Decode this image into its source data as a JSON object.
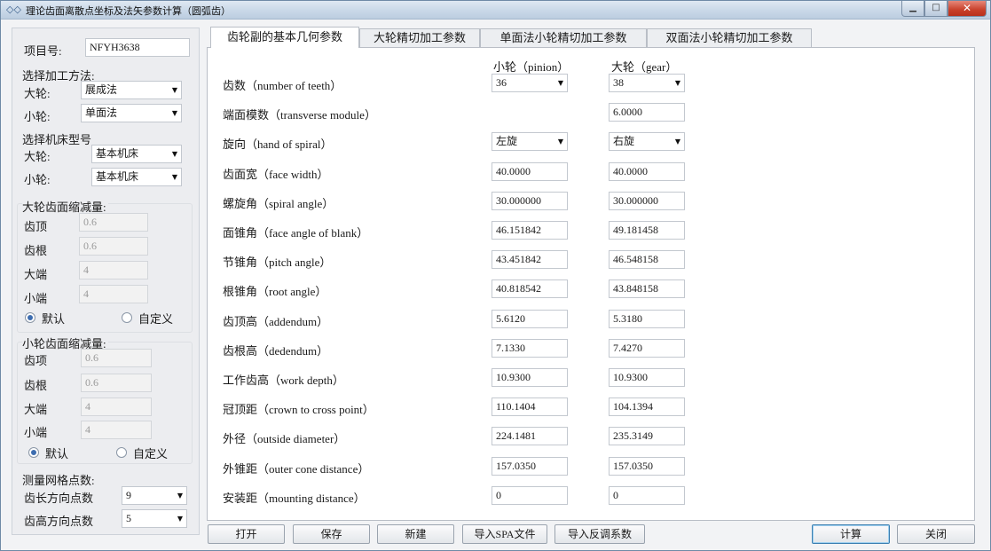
{
  "window": {
    "title": "理论齿面离散点坐标及法矢参数计算（圆弧齿）"
  },
  "left": {
    "project_label": "项目号:",
    "project_value": "NFYH3638",
    "process_title": "选择加工方法:",
    "gear_label": "大轮:",
    "gear_method": "展成法",
    "pinion_label": "小轮:",
    "pinion_method": "单面法",
    "machine_title": "选择机床型号",
    "gear_machine": "基本机床",
    "pinion_machine": "基本机床",
    "gear_reduction": {
      "title": "大轮齿面缩减量:",
      "rows": [
        {
          "label": "齿顶",
          "value": "0.6"
        },
        {
          "label": "齿根",
          "value": "0.6"
        },
        {
          "label": "大端",
          "value": "4"
        },
        {
          "label": "小端",
          "value": "4"
        }
      ],
      "default_label": "默认",
      "custom_label": "自定义"
    },
    "pinion_reduction": {
      "title": "小轮齿面缩减量:",
      "rows": [
        {
          "label": "齿项",
          "value": "0.6"
        },
        {
          "label": "齿根",
          "value": "0.6"
        },
        {
          "label": "大端",
          "value": "4"
        },
        {
          "label": "小端",
          "value": "4"
        }
      ],
      "default_label": "默认",
      "custom_label": "自定义"
    },
    "grid": {
      "title": "测量网格点数:",
      "length_label": "齿长方向点数",
      "length_value": "9",
      "height_label": "齿高方向点数",
      "height_value": "5"
    }
  },
  "tabs": [
    "齿轮副的基本几何参数",
    "大轮精切加工参数",
    "单面法小轮精切加工参数",
    "双面法小轮精切加工参数"
  ],
  "params": {
    "col_pinion": "小轮（pinion）",
    "col_gear": "大轮（gear）",
    "rows": [
      {
        "label": "齿数（number of teeth）",
        "pinion": "36",
        "gear": "38"
      },
      {
        "label": "端面模数（transverse module）",
        "pinion": "",
        "gear": "6.0000"
      },
      {
        "label": "旋向（hand of spiral）",
        "pinion": "左旋",
        "gear": "右旋"
      },
      {
        "label": "齿面宽（face width）",
        "pinion": "40.0000",
        "gear": "40.0000"
      },
      {
        "label": "螺旋角（spiral angle）",
        "pinion": "30.000000",
        "gear": "30.000000"
      },
      {
        "label": "面锥角（face angle of blank）",
        "pinion": "46.151842",
        "gear": "49.181458"
      },
      {
        "label": "节锥角（pitch angle）",
        "pinion": "43.451842",
        "gear": "46.548158"
      },
      {
        "label": "根锥角（root angle）",
        "pinion": "40.818542",
        "gear": "43.848158"
      },
      {
        "label": "齿顶高（addendum）",
        "pinion": "5.6120",
        "gear": "5.3180"
      },
      {
        "label": "齿根高（dedendum）",
        "pinion": "7.1330",
        "gear": "7.4270"
      },
      {
        "label": "工作齿高（work depth）",
        "pinion": "10.9300",
        "gear": "10.9300"
      },
      {
        "label": "冠顶距（crown to cross point）",
        "pinion": "110.1404",
        "gear": "104.1394"
      },
      {
        "label": "外径（outside diameter）",
        "pinion": "224.1481",
        "gear": "235.3149"
      },
      {
        "label": "外锥距（outer cone distance）",
        "pinion": "157.0350",
        "gear": "157.0350"
      },
      {
        "label": "安装距（mounting distance）",
        "pinion": "0",
        "gear": "0"
      }
    ]
  },
  "buttons": {
    "open": "打开",
    "save": "保存",
    "new": "新建",
    "import_spa": "导入SPA文件",
    "import_coef": "导入反调系数",
    "calc": "计算",
    "close": "关闭"
  }
}
